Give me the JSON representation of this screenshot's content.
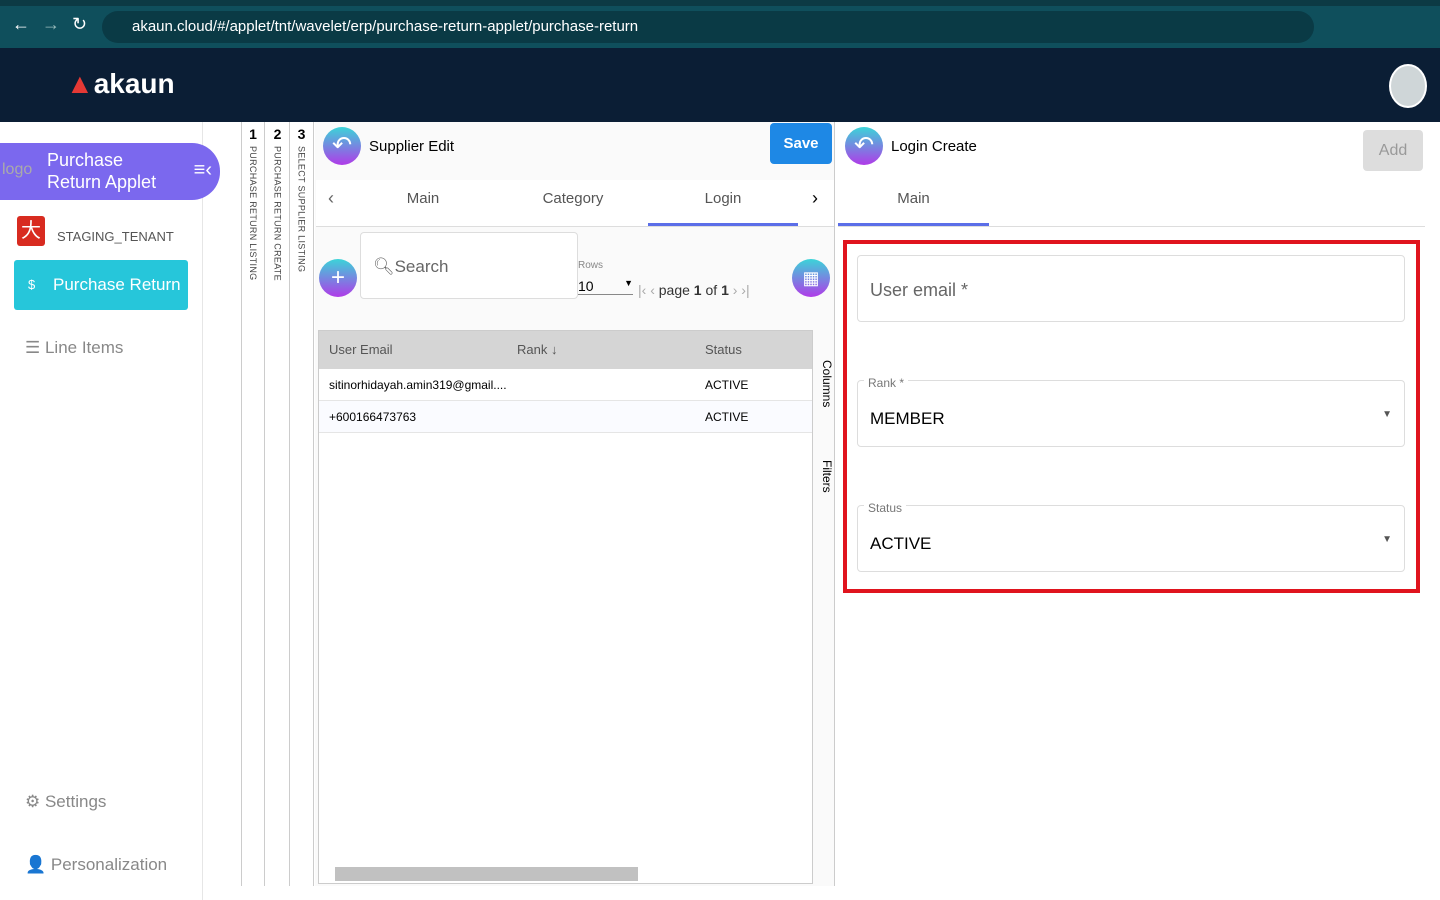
{
  "browser": {
    "url": "akaun.cloud/#/applet/tnt/wavelet/erp/purchase-return-applet/purchase-return"
  },
  "app": {
    "logo": "akaun"
  },
  "sidebar": {
    "applet_title": "Purchase Return Applet",
    "logo_alt": "logo",
    "tenant": "STAGING_TENANT",
    "items": [
      {
        "label": "Purchase Return"
      },
      {
        "label": "Line Items"
      }
    ],
    "settings": "Settings",
    "personalization": "Personalization"
  },
  "steps": [
    {
      "num": "1",
      "label": "PURCHASE RETURN LISTING"
    },
    {
      "num": "2",
      "label": "PURCHASE RETURN CREATE"
    },
    {
      "num": "3",
      "label": "SELECT SUPPLIER LISTING"
    }
  ],
  "supplier": {
    "title": "Supplier Edit",
    "save": "Save",
    "tabs": [
      "Main",
      "Category",
      "Login"
    ],
    "active_tab": "Login",
    "search_placeholder": "Search",
    "rows_label": "Rows",
    "rows_value": "10",
    "page_label": "page",
    "page": "1",
    "of": "of",
    "total": "1",
    "columns": [
      "User Email",
      "Rank",
      "Status"
    ],
    "rows": [
      {
        "email": "sitinorhidayah.amin319@gmail....",
        "rank": "",
        "status": "ACTIVE"
      },
      {
        "email": "+600166473763",
        "rank": "",
        "status": "ACTIVE"
      }
    ],
    "side_columns": "Columns",
    "side_filters": "Filters"
  },
  "login": {
    "title": "Login Create",
    "add": "Add",
    "tab": "Main",
    "email_placeholder": "User email *",
    "rank_label": "Rank *",
    "rank_value": "MEMBER",
    "status_label": "Status",
    "status_value": "ACTIVE"
  },
  "colors": {
    "accent": "#7b68ee",
    "teal": "#26c6da",
    "save": "#1e88e5",
    "highlight": "#e0141e"
  }
}
